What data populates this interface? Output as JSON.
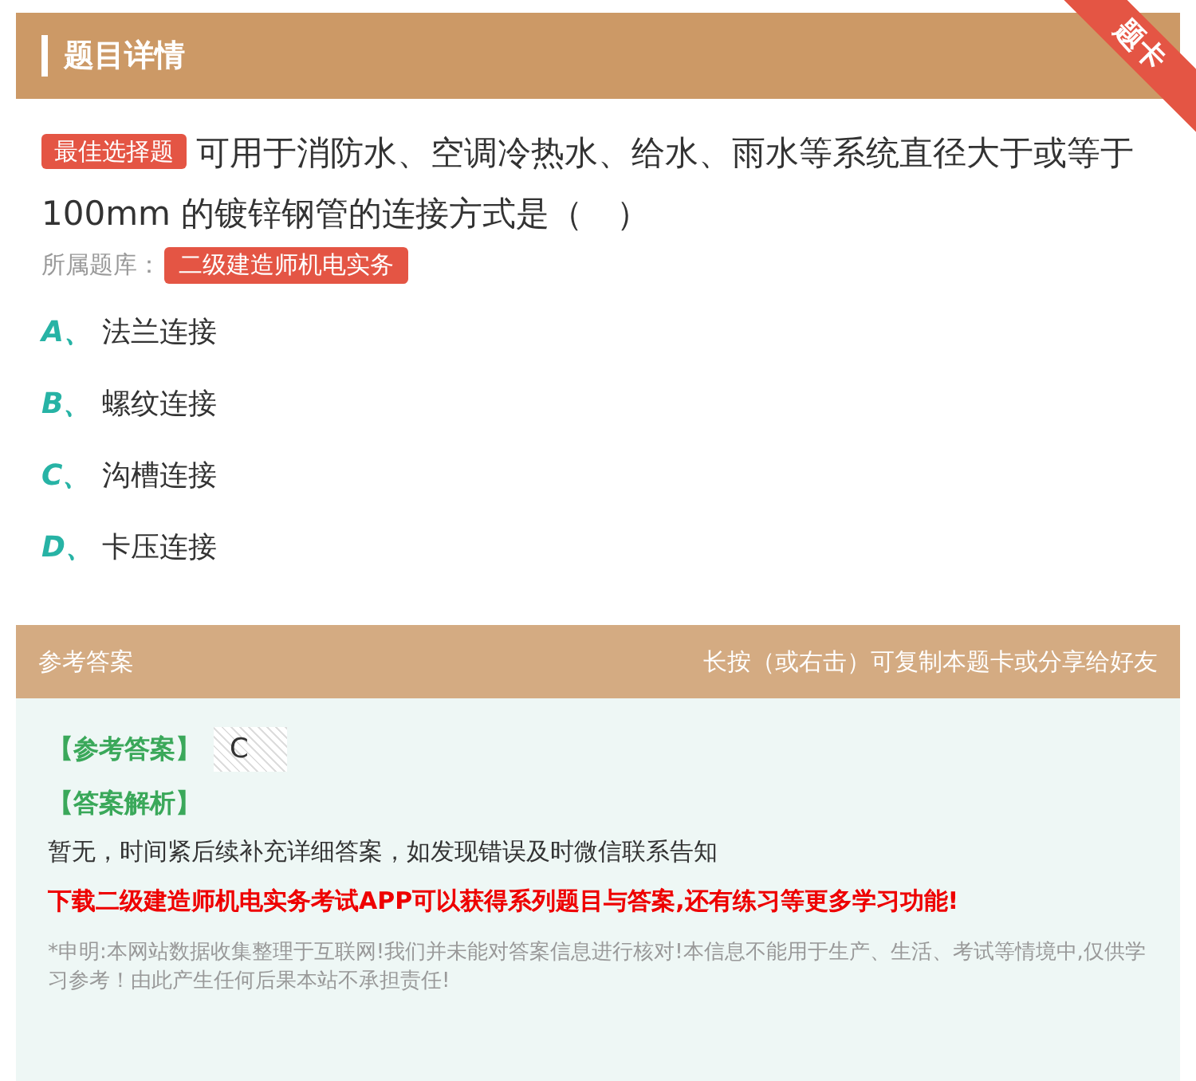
{
  "header": {
    "title": "题目详情",
    "ribbon": "题卡"
  },
  "question": {
    "type_badge": "最佳选择题",
    "text": "可用于消防水、空调冷热水、给水、雨水等系统直径大于或等于 100mm 的镀锌钢管的连接方式是（　）",
    "bank_label": "所属题库：",
    "bank": "二级建造师机电实务"
  },
  "options": [
    {
      "letter": "A、",
      "text": "法兰连接"
    },
    {
      "letter": "B、",
      "text": "螺纹连接"
    },
    {
      "letter": "C、",
      "text": "沟槽连接"
    },
    {
      "letter": "D、",
      "text": "卡压连接"
    }
  ],
  "answer_bar": {
    "title": "参考答案",
    "hint": "长按（或右击）可复制本题卡或分享给好友"
  },
  "answer": {
    "answer_label": "【参考答案】",
    "answer_value": "C",
    "analysis_label": "【答案解析】",
    "analysis": "暂无，时间紧后续补充详细答案，如发现错误及时微信联系告知",
    "promo": "下载二级建造师机电实务考试APP可以获得系列题目与答案,还有练习等更多学习功能!",
    "disclaimer": "*申明:本网站数据收集整理于互联网!我们并未能对答案信息进行核对!本信息不能用于生产、生活、考试等情境中,仅供学习参考！由此产生任何后果本站不承担责任!"
  }
}
